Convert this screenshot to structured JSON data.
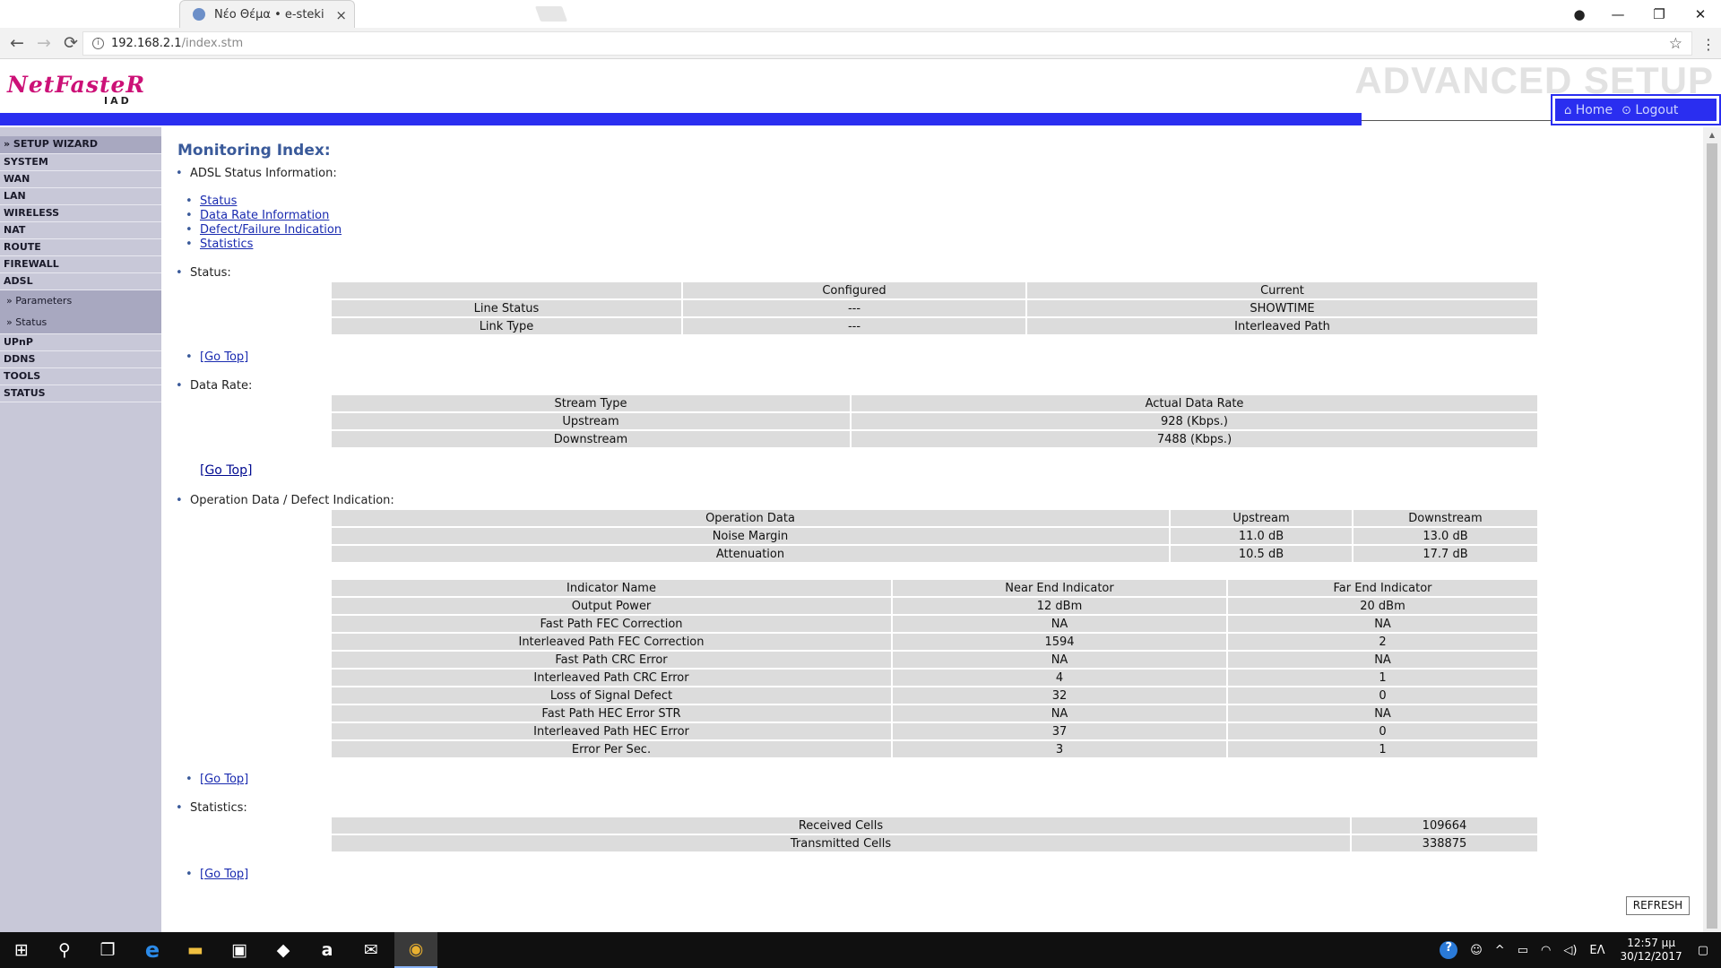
{
  "browser": {
    "tab_title": "Νέο Θέμα • e-steki",
    "tab_close": "×",
    "url_host": "192.168.2.1",
    "url_path": "/index.stm",
    "nav_back": "←",
    "nav_forward": "→",
    "nav_reload": "⟳",
    "star": "☆",
    "menu": "⋮",
    "minimize": "—",
    "restore": "❐",
    "close": "✕",
    "account": "●"
  },
  "header": {
    "brand": "NetFasteR",
    "brand_sub": "IAD",
    "advanced_setup": "ADVANCED SETUP",
    "home": "Home",
    "logout": "Logout",
    "home_icon": "⌂",
    "logout_icon": "⊙"
  },
  "sidebar": {
    "items": [
      {
        "label": "» SETUP WIZARD"
      },
      {
        "label": "SYSTEM"
      },
      {
        "label": "WAN"
      },
      {
        "label": "LAN"
      },
      {
        "label": "WIRELESS"
      },
      {
        "label": "NAT"
      },
      {
        "label": "ROUTE"
      },
      {
        "label": "FIREWALL"
      },
      {
        "label": "ADSL"
      }
    ],
    "subitems": [
      {
        "label": "» Parameters"
      },
      {
        "label": "» Status"
      }
    ],
    "items_after": [
      {
        "label": "UPnP"
      },
      {
        "label": "DDNS"
      },
      {
        "label": "TOOLS"
      },
      {
        "label": "STATUS"
      }
    ]
  },
  "main": {
    "title": "Monitoring Index:",
    "adsl_info_heading": "ADSL Status Information:",
    "links": [
      "Status",
      "Data Rate Information",
      "Defect/Failure Indication",
      "Statistics"
    ],
    "status_heading": "Status:",
    "status_table": {
      "headers": [
        "",
        "Configured",
        "Current"
      ],
      "rows": [
        [
          "Line Status",
          "---",
          "SHOWTIME"
        ],
        [
          "Link Type",
          "---",
          "Interleaved Path"
        ]
      ]
    },
    "go_top": "[Go Top]",
    "data_rate_heading": "Data Rate:",
    "data_rate_table": {
      "headers": [
        "Stream Type",
        "Actual Data Rate"
      ],
      "rows": [
        [
          "Upstream",
          "928 (Kbps.)"
        ],
        [
          "Downstream",
          "7488 (Kbps.)"
        ]
      ]
    },
    "operation_heading": "Operation Data / Defect Indication:",
    "operation_table": {
      "headers": [
        "Operation Data",
        "Upstream",
        "Downstream"
      ],
      "rows": [
        [
          "Noise Margin",
          "11.0 dB",
          "13.0 dB"
        ],
        [
          "Attenuation",
          "10.5 dB",
          "17.7 dB"
        ]
      ]
    },
    "indicator_table": {
      "headers": [
        "Indicator Name",
        "Near End Indicator",
        "Far End Indicator"
      ],
      "rows": [
        [
          "Output Power",
          "12 dBm",
          "20 dBm"
        ],
        [
          "Fast Path FEC Correction",
          "NA",
          "NA"
        ],
        [
          "Interleaved Path FEC Correction",
          "1594",
          "2"
        ],
        [
          "Fast Path CRC Error",
          "NA",
          "NA"
        ],
        [
          "Interleaved Path CRC Error",
          "4",
          "1"
        ],
        [
          "Loss of Signal Defect",
          "32",
          "0"
        ],
        [
          "Fast Path HEC Error STR",
          "NA",
          "NA"
        ],
        [
          "Interleaved Path HEC Error",
          "37",
          "0"
        ],
        [
          "Error Per Sec.",
          "3",
          "1"
        ]
      ]
    },
    "statistics_heading": "Statistics:",
    "statistics_table": {
      "rows": [
        [
          "Received Cells",
          "109664"
        ],
        [
          "Transmitted Cells",
          "338875"
        ]
      ]
    },
    "refresh": "REFRESH"
  },
  "taskbar": {
    "start_icon": "⊞",
    "search_icon": "⚲",
    "taskview_icon": "❐",
    "edge_icon": "e",
    "explorer_icon": "▬",
    "store_icon": "▣",
    "dropbox_icon": "◆",
    "amazon_icon": "a",
    "mail_icon": "✉",
    "chrome_icon": "◉",
    "help_icon": "?",
    "people_icon": "☺",
    "chevron_icon": "^",
    "battery_icon": "▭",
    "network_icon": "◠",
    "volume_icon": "◁)",
    "language": "EΛ",
    "time": "12:57 μμ",
    "date": "30/12/2017",
    "notifications_icon": "▢"
  }
}
